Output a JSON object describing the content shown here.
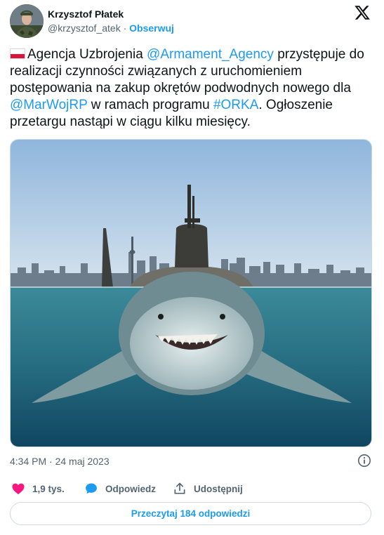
{
  "author": {
    "display_name": "Krzysztof Płatek",
    "handle": "@krzysztof_atek",
    "separator": "·",
    "follow_label": "Obserwuj"
  },
  "tweet": {
    "text_1": "Agencja Uzbrojenia ",
    "mention_1": "@Armament_Agency",
    "text_2": " przystępuje do realizacji czynności związanych z uruchomieniem postępowania na zakup okrętów podwodnych nowego dla ",
    "mention_2": "@MarWojRP",
    "text_3": " w ramach programu ",
    "hashtag": "#ORKA",
    "text_4": ". Ogłoszenie przetargu nastąpi w ciągu kilku miesięcy."
  },
  "timestamp": "4:34 PM · 24 maj 2023",
  "actions": {
    "like_count": "1,9 tys.",
    "reply_label": "Odpowiedz",
    "share_label": "Udostępnij"
  },
  "read_replies_label": "Przeczytaj 184 odpowiedzi",
  "icons": {
    "brand": "x-logo-icon",
    "info": "info-icon",
    "like": "heart-icon",
    "reply": "speech-bubble-icon",
    "share": "share-upload-icon"
  },
  "colors": {
    "link": "#1d9bf0",
    "like": "#f91880",
    "text": "#0f1419",
    "muted": "#536471"
  }
}
